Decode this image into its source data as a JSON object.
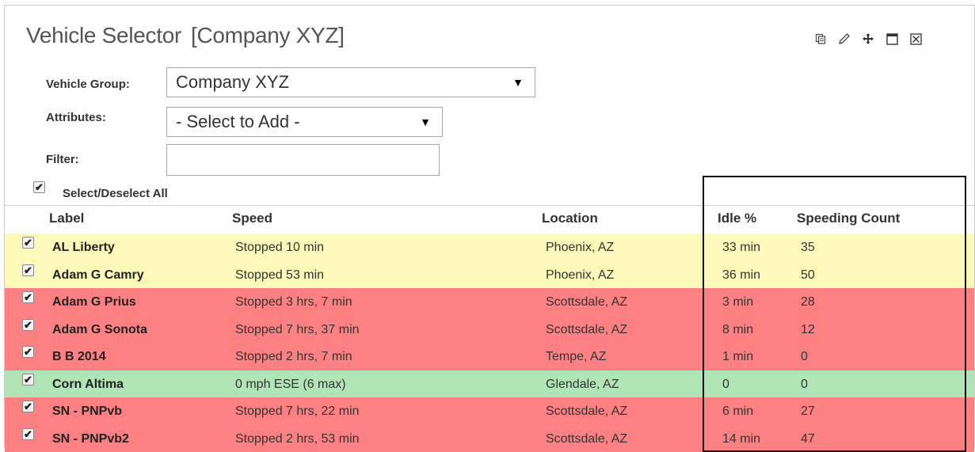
{
  "title": {
    "main": "Vehicle Selector",
    "company": "[Company XYZ]"
  },
  "window_icons": [
    "copy-icon",
    "edit-pencil-icon",
    "move-icon",
    "maximize-icon",
    "close-icon"
  ],
  "form": {
    "vehicle_group_label": "Vehicle Group:",
    "vehicle_group_value": "Company XYZ",
    "attributes_label": "Attributes:",
    "attributes_value": "- Select to Add -",
    "filter_label": "Filter:",
    "filter_value": ""
  },
  "select_all_label": "Select/Deselect All",
  "columns": {
    "label": "Label",
    "speed": "Speed",
    "location": "Location",
    "idle": "Idle %",
    "speeding": "Speeding Count"
  },
  "status_colors": {
    "yellow": "#fdf9b9",
    "red": "#fd8183",
    "green": "#b1e4b7"
  },
  "rows": [
    {
      "label": "AL Liberty",
      "speed": "Stopped 10 min",
      "location": "Phoenix, AZ",
      "idle": "33 min",
      "speeding": "35",
      "status": "yellow",
      "checked": true
    },
    {
      "label": "Adam G Camry",
      "speed": "Stopped 53 min",
      "location": "Phoenix, AZ",
      "idle": "36 min",
      "speeding": "50",
      "status": "yellow",
      "checked": true
    },
    {
      "label": "Adam G Prius",
      "speed": "Stopped 3 hrs, 7 min",
      "location": "Scottsdale, AZ",
      "idle": "3 min",
      "speeding": "28",
      "status": "red",
      "checked": true
    },
    {
      "label": "Adam G Sonota",
      "speed": "Stopped 7 hrs, 37 min",
      "location": "Scottsdale, AZ",
      "idle": "8 min",
      "speeding": "12",
      "status": "red",
      "checked": true
    },
    {
      "label": "B B 2014",
      "speed": "Stopped 2 hrs, 7 min",
      "location": "Tempe, AZ",
      "idle": "1 min",
      "speeding": "0",
      "status": "red",
      "checked": true
    },
    {
      "label": "Corn Altima",
      "speed": "0 mph ESE (6 max)",
      "location": "Glendale, AZ",
      "idle": "0",
      "speeding": "0",
      "status": "green",
      "checked": true
    },
    {
      "label": "SN - PNPvb",
      "speed": "Stopped 7 hrs, 22 min",
      "location": "Scottsdale, AZ",
      "idle": "6 min",
      "speeding": "27",
      "status": "red",
      "checked": true
    },
    {
      "label": "SN - PNPvb2",
      "speed": "Stopped 2 hrs, 53 min",
      "location": "Scottsdale, AZ",
      "idle": "14 min",
      "speeding": "47",
      "status": "red",
      "checked": true
    }
  ]
}
